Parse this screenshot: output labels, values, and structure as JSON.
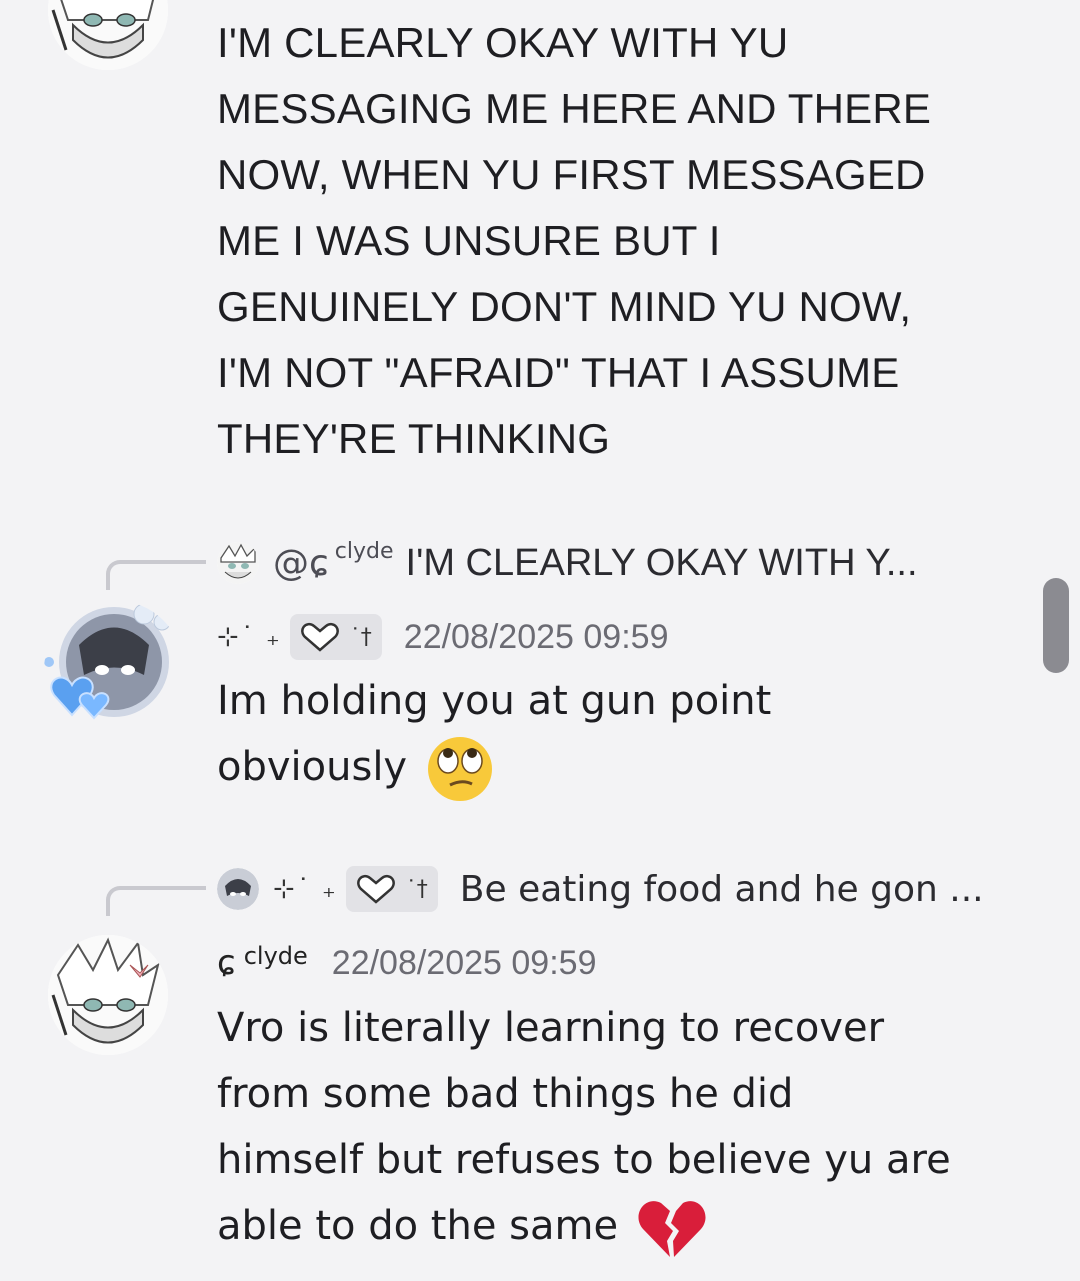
{
  "messages": [
    {
      "id": "msg1",
      "text": "I'M CLEARLY OKAY WITH YU\nMESSAGING ME HERE AND THERE\nNOW, WHEN YU FIRST MESSAGED\nME I WAS UNSURE BUT I\nGENUINELY DON'T MIND YU NOW,\nI'M NOT \"AFRAID\" THAT I ASSUME\nTHEY'RE THINKING"
    },
    {
      "id": "msg2",
      "reply": {
        "mention": "@ɕ",
        "mention_sup": "clyde",
        "text": "I'M CLEARLY OKAY WITH Y..."
      },
      "author_deco": "⊹˙ ₊",
      "author_tag_cross": "˙†\n.",
      "timestamp": "22/08/2025 09:59",
      "text": "Im holding you at gun point\nobviously",
      "emoji": "eye-roll-emoji"
    },
    {
      "id": "msg3",
      "reply": {
        "author_deco": "⊹˙ ₊",
        "text": "Be eating food and he gon ..."
      },
      "author_hook": "ɕ",
      "author_name": "clyde",
      "timestamp": "22/08/2025 09:59",
      "text": "Vro is literally learning to recover\nfrom some bad things he did\nhimself but refuses to believe yu are\nable to do the same",
      "emoji": "broken-heart-emoji"
    }
  ],
  "colors": {
    "background": "#f3f3f5",
    "text": "#1e1e22",
    "timestamp": "#6b6b73",
    "scrollbar": "#8b8b91"
  }
}
